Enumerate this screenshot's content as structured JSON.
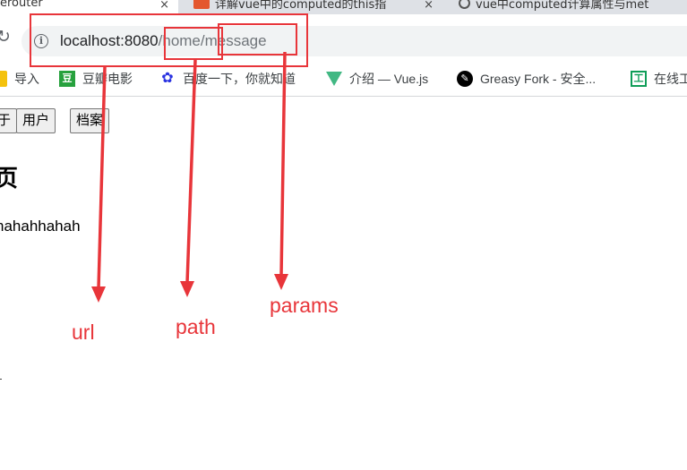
{
  "tabs": [
    {
      "title": "erouter",
      "close": "×",
      "active": true
    },
    {
      "title": "详解vue中的computed的this指",
      "close": "×"
    },
    {
      "title": "vue中computed计算属性与met"
    }
  ],
  "toolbar": {
    "reload_icon": "reload-icon",
    "info_icon": "info-icon",
    "url_host": "localhost:8080",
    "url_path": "/home",
    "url_params": "/message"
  },
  "bookmarks": [
    {
      "label": "导入",
      "icon": "folder-icon"
    },
    {
      "label": "豆瓣电影",
      "icon": "douban-icon"
    },
    {
      "label": "百度一下，你就知道",
      "icon": "baidu-icon"
    },
    {
      "label": "介绍 — Vue.js",
      "icon": "vue-icon"
    },
    {
      "label": "Greasy Fork - 安全...",
      "icon": "greasyfork-icon"
    },
    {
      "label": "在线工",
      "icon": "online-tool-icon"
    }
  ],
  "page": {
    "nav_buttons": [
      "于",
      "用户",
      "档案"
    ],
    "heading": "页",
    "message": "hahahhahah"
  },
  "annotations": {
    "url_label": "url",
    "path_label": "path",
    "params_label": "params",
    "color": "#e8353a"
  }
}
